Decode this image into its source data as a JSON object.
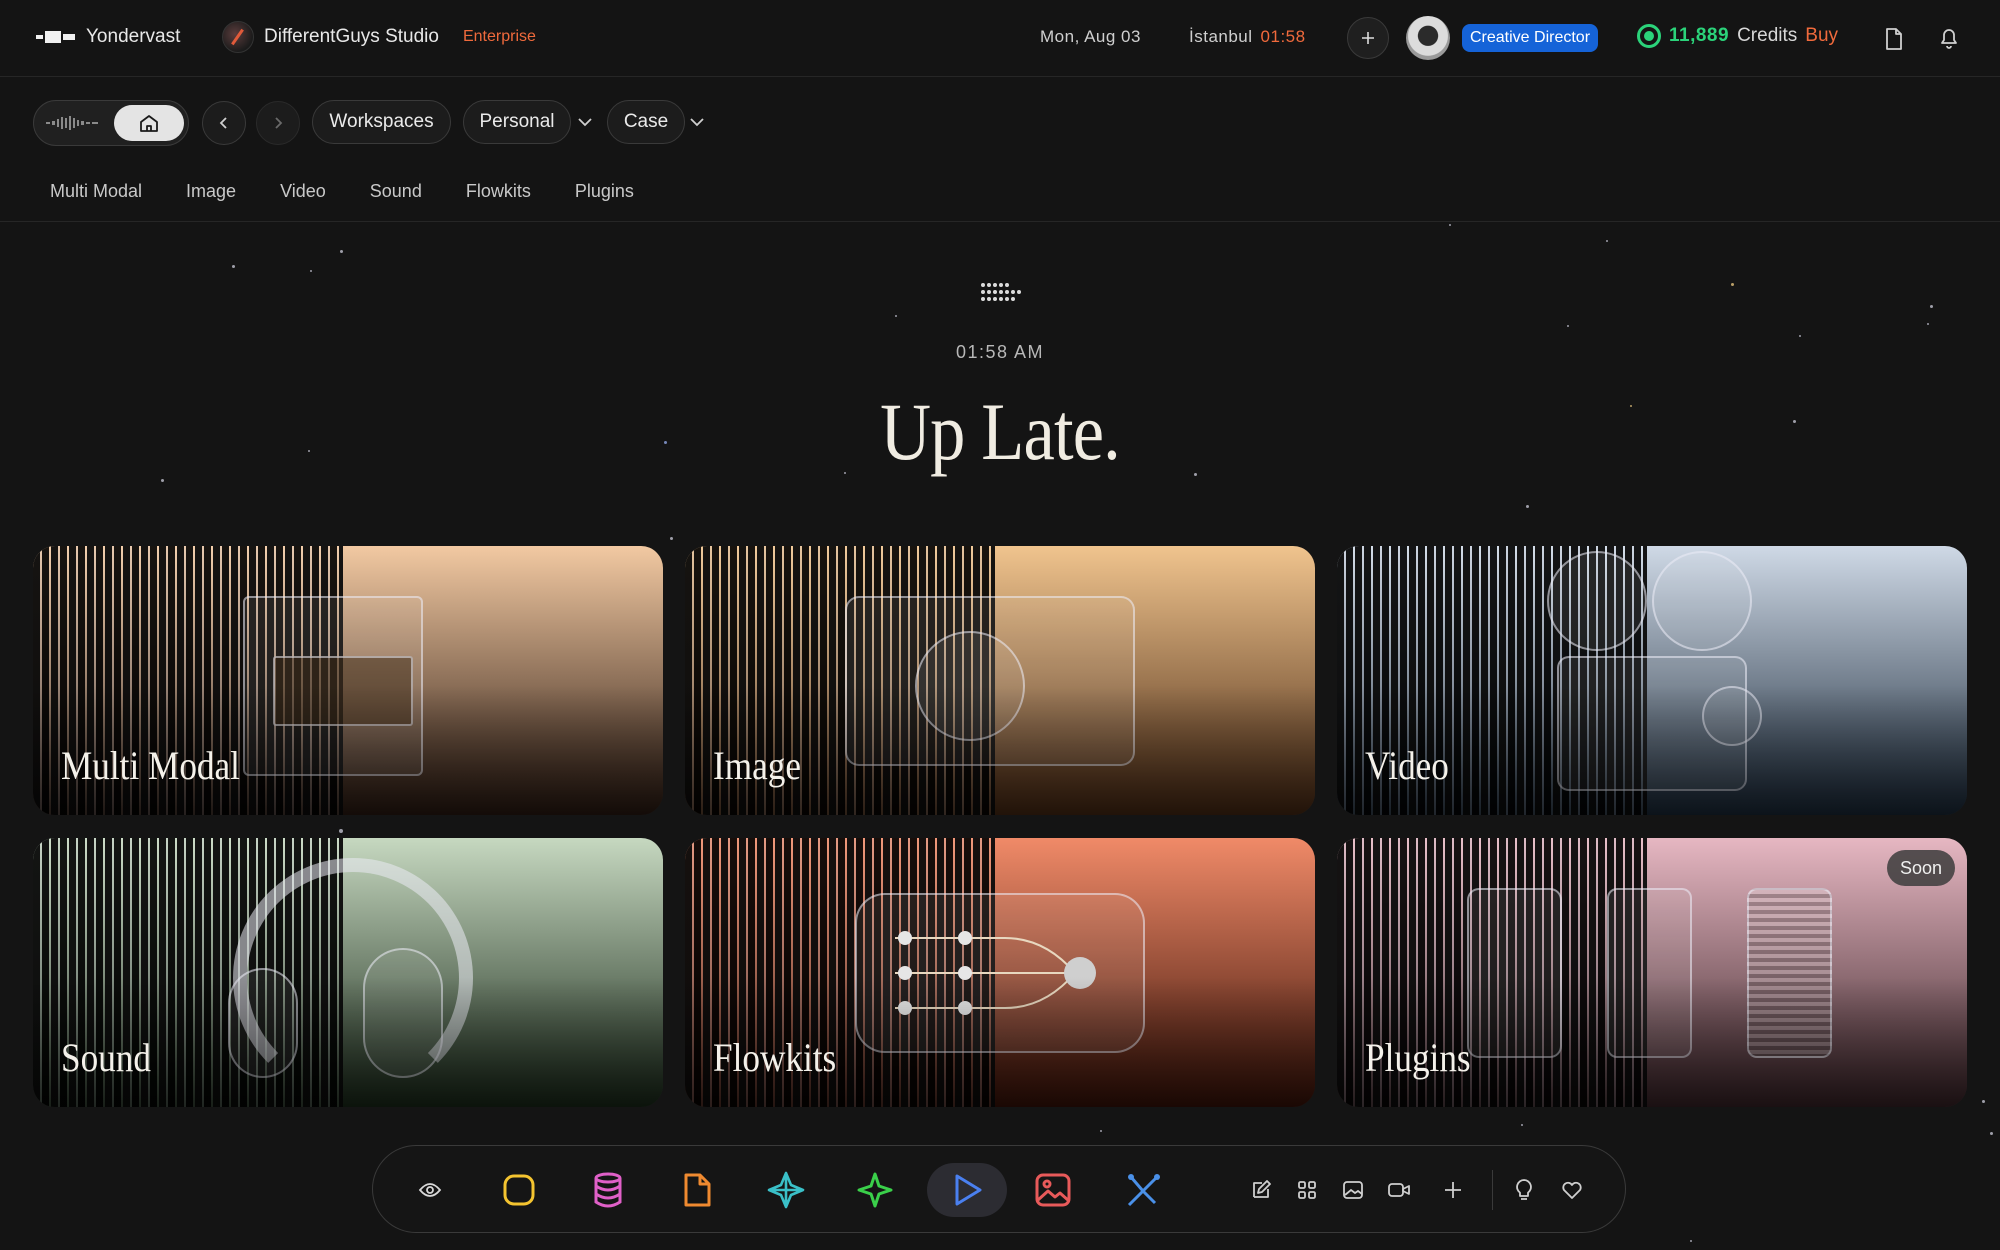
{
  "topbar": {
    "brand": "Yondervast",
    "studio": "DifferentGuys Studio",
    "plan": "Enterprise",
    "date": "Mon, Aug 03",
    "city": "İstanbul",
    "city_time": "01:58",
    "role": "Creative Director",
    "credits": "11,889",
    "credits_label": "Credits",
    "buy_label": "Buy"
  },
  "nav": {
    "workspaces": "Workspaces",
    "personal": "Personal",
    "case": "Case"
  },
  "tabs": [
    "Multi Modal",
    "Image",
    "Video",
    "Sound",
    "Flowkits",
    "Plugins"
  ],
  "hero": {
    "time": "01:58 AM",
    "title": "Up Late."
  },
  "cards": [
    {
      "label": "Multi Modal",
      "colors": [
        "#f2c9a2",
        "#2b1a12"
      ]
    },
    {
      "label": "Image",
      "colors": [
        "#f0c48e",
        "#4a2a14"
      ]
    },
    {
      "label": "Video",
      "colors": [
        "#cfd9e6",
        "#1b2a3a"
      ]
    },
    {
      "label": "Sound",
      "colors": [
        "#c6d8c0",
        "#1a2a1a"
      ]
    },
    {
      "label": "Flowkits",
      "colors": [
        "#f08a68",
        "#3a1208"
      ]
    },
    {
      "label": "Plugins",
      "colors": [
        "#e6b7c2",
        "#3a2428"
      ],
      "badge": "Soon"
    }
  ],
  "dock": {
    "items": [
      "eye-icon",
      "square-icon",
      "database-icon",
      "file-icon",
      "compass-star-icon",
      "sparkle-icon",
      "play-icon",
      "image-icon",
      "branch-icon"
    ],
    "tools": [
      "edit-icon",
      "grid-icon",
      "picture-icon",
      "video-camera-icon",
      "plus-icon",
      "bulb-icon",
      "heart-icon"
    ]
  }
}
